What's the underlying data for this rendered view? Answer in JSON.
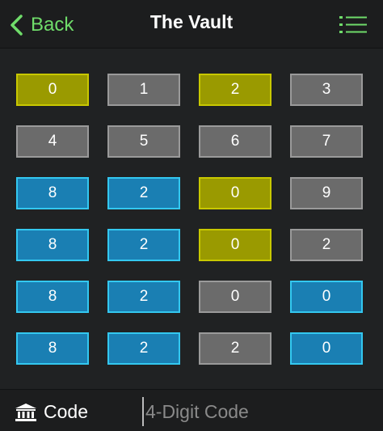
{
  "header": {
    "back_label": "Back",
    "title": "The Vault",
    "back_icon": "chevron-left-icon",
    "menu_icon": "list-menu-icon"
  },
  "colors": {
    "accent": "#6fdc6a",
    "gray_tile": "#6b6b6b",
    "yellow_tile": "#9a9a00",
    "blue_tile": "#1a7fb3",
    "background": "#202223"
  },
  "grid": {
    "rows": [
      [
        {
          "digit": "0",
          "state": "yellow"
        },
        {
          "digit": "1",
          "state": "gray"
        },
        {
          "digit": "2",
          "state": "yellow"
        },
        {
          "digit": "3",
          "state": "gray"
        }
      ],
      [
        {
          "digit": "4",
          "state": "gray"
        },
        {
          "digit": "5",
          "state": "gray"
        },
        {
          "digit": "6",
          "state": "gray"
        },
        {
          "digit": "7",
          "state": "gray"
        }
      ],
      [
        {
          "digit": "8",
          "state": "blue"
        },
        {
          "digit": "2",
          "state": "blue"
        },
        {
          "digit": "0",
          "state": "yellow"
        },
        {
          "digit": "9",
          "state": "gray"
        }
      ],
      [
        {
          "digit": "8",
          "state": "blue"
        },
        {
          "digit": "2",
          "state": "blue"
        },
        {
          "digit": "0",
          "state": "yellow"
        },
        {
          "digit": "2",
          "state": "gray"
        }
      ],
      [
        {
          "digit": "8",
          "state": "blue"
        },
        {
          "digit": "2",
          "state": "blue"
        },
        {
          "digit": "0",
          "state": "gray"
        },
        {
          "digit": "0",
          "state": "blue"
        }
      ],
      [
        {
          "digit": "8",
          "state": "blue"
        },
        {
          "digit": "2",
          "state": "blue"
        },
        {
          "digit": "2",
          "state": "gray"
        },
        {
          "digit": "0",
          "state": "blue"
        }
      ]
    ]
  },
  "footer": {
    "code_label": "Code",
    "code_icon": "bank-icon",
    "input_value": "",
    "input_placeholder": "4-Digit Code"
  }
}
